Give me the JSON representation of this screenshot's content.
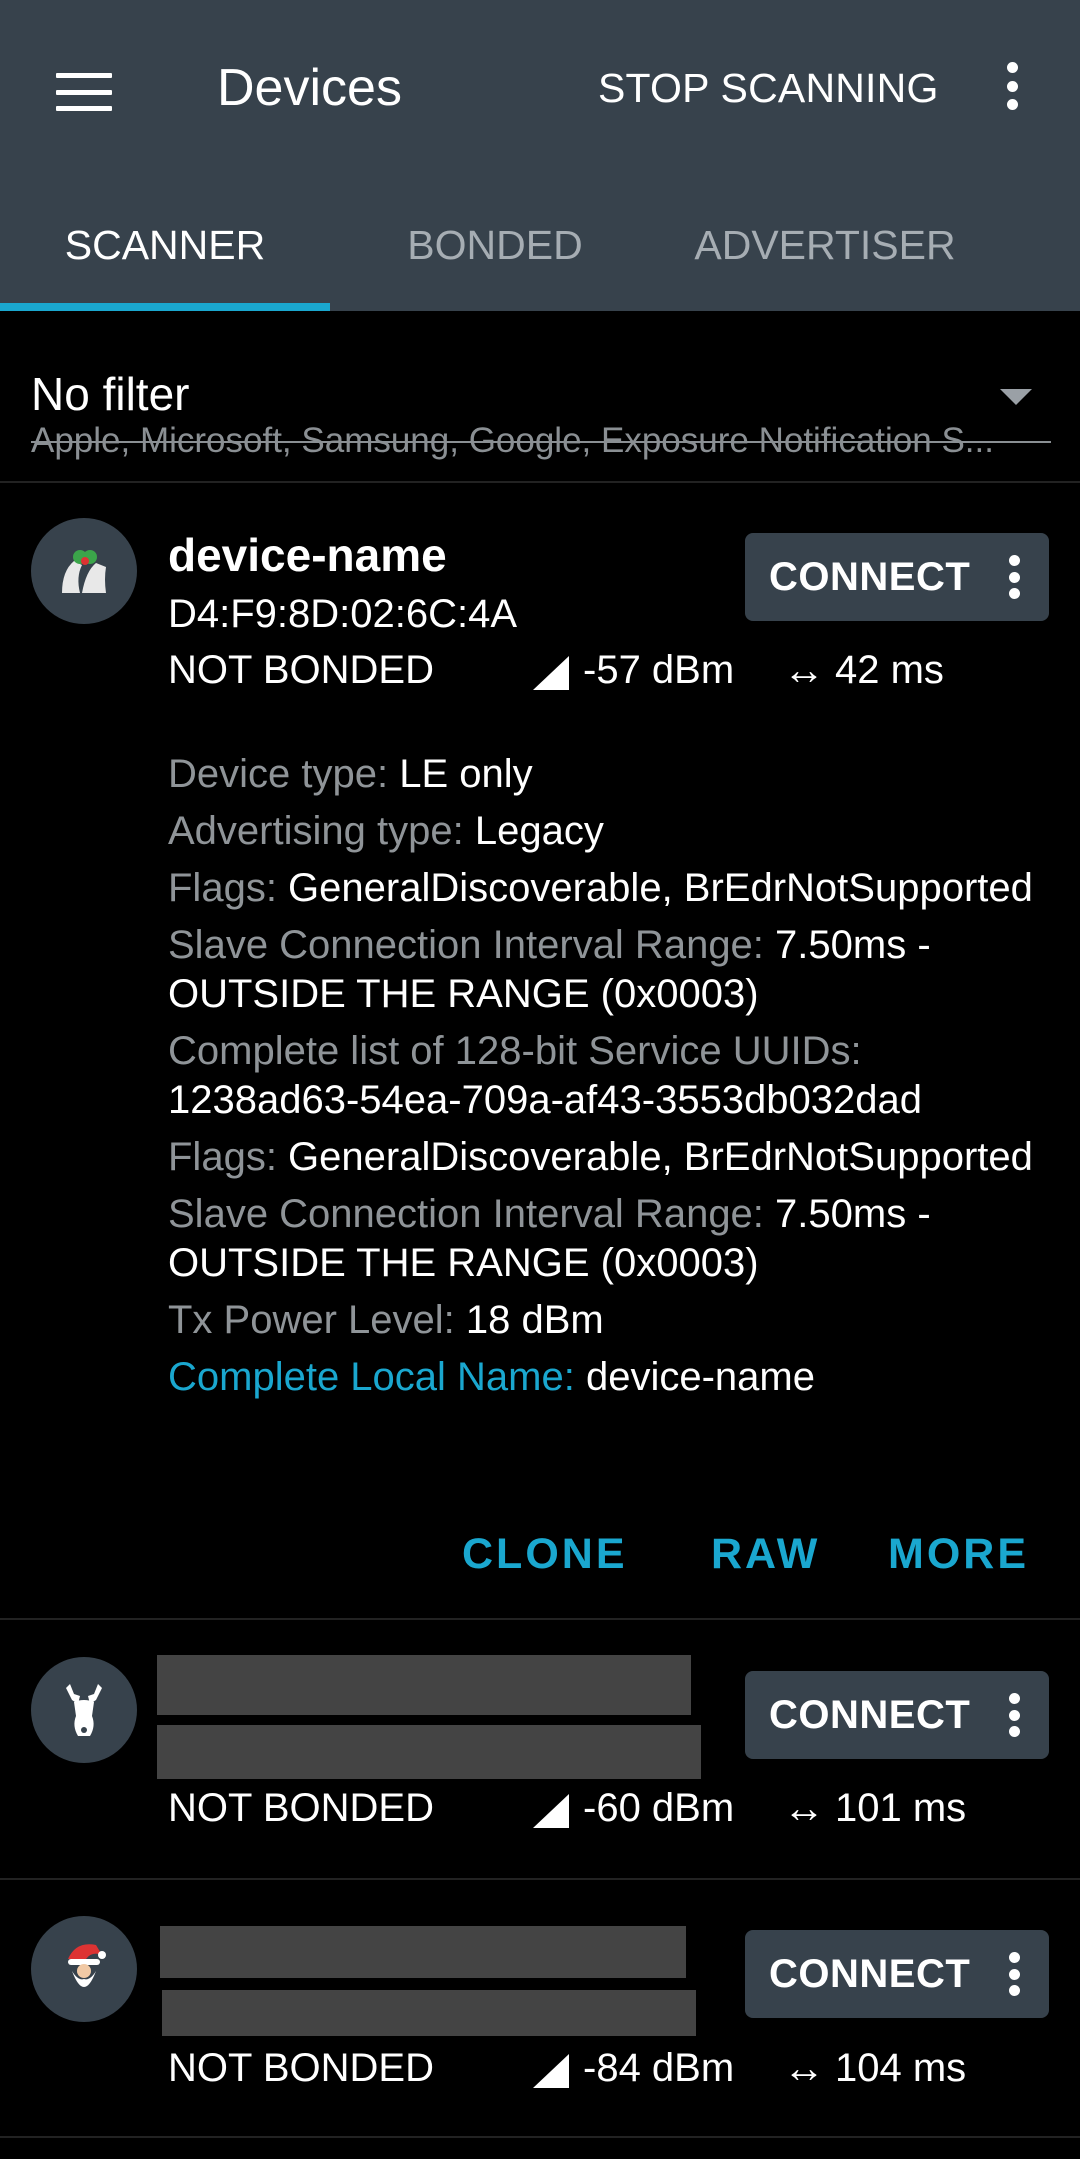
{
  "appbar": {
    "title": "Devices",
    "stop_scanning": "STOP SCANNING",
    "colors": {
      "background": "#37424c",
      "accent": "#1aa7cf"
    }
  },
  "tabs": [
    {
      "label": "SCANNER",
      "active": true
    },
    {
      "label": "BONDED",
      "active": false
    },
    {
      "label": "ADVERTISER",
      "active": false
    }
  ],
  "filter": {
    "title": "No filter",
    "subtitle": "Apple, Microsoft, Samsung, Google, Exposure Notification S..."
  },
  "devices": [
    {
      "icon": "bells-icon",
      "name": "device-name",
      "address": "D4:F9:8D:02:6C:4A",
      "bond_state": "NOT BONDED",
      "rssi": "-57 dBm",
      "interval": "42 ms",
      "connect": "CONNECT",
      "details": [
        {
          "key": "Device type: ",
          "value": "LE only"
        },
        {
          "key": "Advertising type: ",
          "value": "Legacy"
        },
        {
          "key": "Flags: ",
          "value": "GeneralDiscoverable, BrEdrNotSupported"
        },
        {
          "key": "Slave Connection Interval Range: ",
          "value": "7.50ms - OUTSIDE THE RANGE (0x0003)"
        },
        {
          "key": "Complete list of 128-bit Service UUIDs: ",
          "value": "1238ad63-54ea-709a-af43-3553db032dad"
        },
        {
          "key": "Flags: ",
          "value": "GeneralDiscoverable, BrEdrNotSupported"
        },
        {
          "key": "Slave Connection Interval Range: ",
          "value": "7.50ms - OUTSIDE THE RANGE (0x0003)"
        },
        {
          "key": "Tx Power Level: ",
          "value": "18 dBm"
        },
        {
          "key": "Complete Local Name: ",
          "value": "device-name"
        }
      ],
      "actions": {
        "clone": "CLONE",
        "raw": "RAW",
        "more": "MORE"
      }
    },
    {
      "icon": "reindeer-icon",
      "bond_state": "NOT BONDED",
      "rssi": "-60 dBm",
      "interval": "101 ms",
      "connect": "CONNECT"
    },
    {
      "icon": "santa-icon",
      "bond_state": "NOT BONDED",
      "rssi": "-84 dBm",
      "interval": "104 ms",
      "connect": "CONNECT"
    }
  ]
}
